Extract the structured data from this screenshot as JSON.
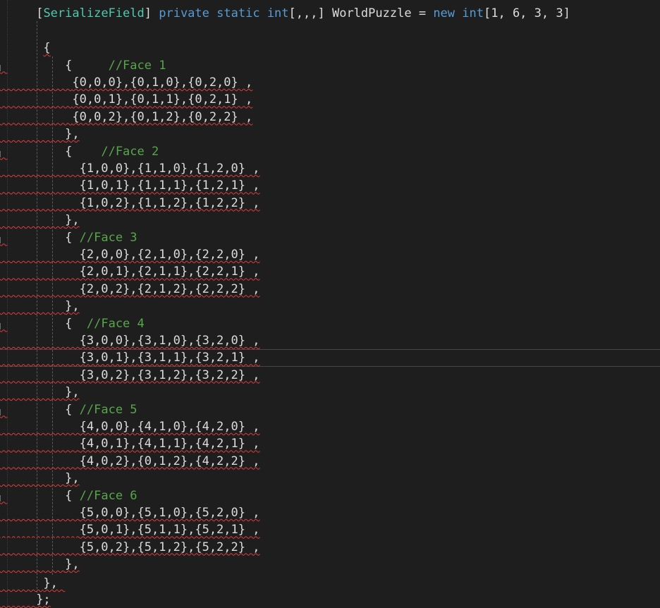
{
  "code": {
    "declaration": {
      "open_bracket": "[",
      "attribute": "SerializeField",
      "close_bracket": "]",
      "mod_private": "private",
      "mod_static": "static",
      "type_int": "int",
      "rank": "[,,,]",
      "name": "WorldPuzzle",
      "equals": "=",
      "kw_new": "new",
      "type_int2": "int",
      "dims": "[1, 6, 3, 3]"
    },
    "outer_open": "{",
    "faces": [
      {
        "open": "{",
        "comment": "//Face 1",
        "rows": [
          "{0,0,0},{0,1,0},{0,2,0} ,",
          "{0,0,1},{0,1,1},{0,2,1} ,",
          "{0,0,2},{0,1,2},{0,2,2} ,"
        ],
        "close": "},"
      },
      {
        "open": "{",
        "comment": "//Face 2",
        "rows": [
          "{1,0,0},{1,1,0},{1,2,0} ,",
          "{1,0,1},{1,1,1},{1,2,1} ,",
          "{1,0,2},{1,1,2},{1,2,2} ,"
        ],
        "close": "},"
      },
      {
        "open": "{",
        "comment": "//Face 3",
        "rows": [
          "{2,0,0},{2,1,0},{2,2,0} ,",
          "{2,0,1},{2,1,1},{2,2,1} ,",
          "{2,0,2},{2,1,2},{2,2,2} ,"
        ],
        "close": "},"
      },
      {
        "open": "{",
        "comment": "//Face 4",
        "rows": [
          "{3,0,0},{3,1,0},{3,2,0} ,",
          "{3,0,1},{3,1,1},{3,2,1} ,",
          "{3,0,2},{3,1,2},{3,2,2} ,"
        ],
        "close": "},"
      },
      {
        "open": "{",
        "comment": "//Face 5",
        "rows": [
          "{4,0,0},{4,1,0},{4,2,0} ,",
          "{4,0,1},{4,1,1},{4,2,1} ,",
          "{4,0,2},{0,1,2},{4,2,2} ,"
        ],
        "close": "},"
      },
      {
        "open": "{",
        "comment": "//Face 6",
        "rows": [
          "{5,0,0},{5,1,0},{5,2,0} ,",
          "{5,0,1},{5,1,1},{5,2,1} ,",
          "{5,0,2},{5,1,2},{5,2,2} ,"
        ],
        "close": "},"
      }
    ],
    "outer_close": "},",
    "end": "};"
  },
  "colors": {
    "background": "#1e1e1e",
    "keyword": "#569cd6",
    "type_name": "#4ec9b0",
    "comment": "#57a64a",
    "text": "#dcdcdc",
    "error_squiggle": "#e03c3c"
  }
}
